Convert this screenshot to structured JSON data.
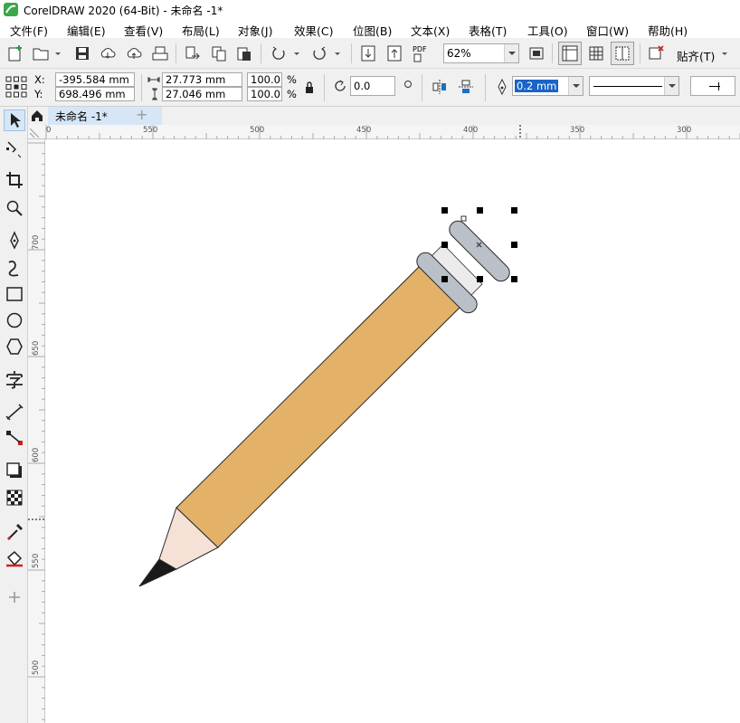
{
  "window": {
    "title": "CorelDRAW 2020 (64-Bit) - 未命名 -1*"
  },
  "menu": [
    "文件(F)",
    "编辑(E)",
    "查看(V)",
    "布局(L)",
    "对象(J)",
    "效果(C)",
    "位图(B)",
    "文本(X)",
    "表格(T)",
    "工具(O)",
    "窗口(W)",
    "帮助(H)"
  ],
  "toolbar": {
    "zoom_value": "62%",
    "pdf_label": "PDF",
    "snap_label": "贴齐(T)"
  },
  "props": {
    "x_label": "X:",
    "x_value": "-395.584 mm",
    "y_label": "Y:",
    "y_value": "698.496 mm",
    "w_value": "27.773 mm",
    "h_value": "27.046 mm",
    "scale_w": "100.0",
    "scale_h": "100.0",
    "pct": "%",
    "rotation": "0.0",
    "outline_width": "0.2 mm"
  },
  "document": {
    "tab_label": "未命名 -1*",
    "add_tab": "+"
  },
  "rulers": {
    "horizontal": [
      "0",
      "550",
      "500",
      "450",
      "400",
      "350",
      "300"
    ],
    "vertical": [
      "700",
      "650",
      "600",
      "550",
      "500"
    ]
  },
  "toolbox": [
    "pick-tool",
    "shape-tool",
    "crop-tool",
    "zoom-tool",
    "freehand-tool",
    "artistic-media-tool",
    "rectangle-tool",
    "ellipse-tool",
    "polygon-tool",
    "text-tool",
    "parallel-dimension-tool",
    "connector-tool",
    "drop-shadow-tool",
    "transparency-tool",
    "eyedropper-tool",
    "interactive-fill-tool",
    "add-tool"
  ],
  "drawing": {
    "colors": {
      "tip": "#1a1a1a",
      "wood": "#f5e1d6",
      "body": "#e3b167",
      "ferrule": "#b9c0c8",
      "eraser": "#ebebeb",
      "outline": "#2a2a2a"
    }
  }
}
